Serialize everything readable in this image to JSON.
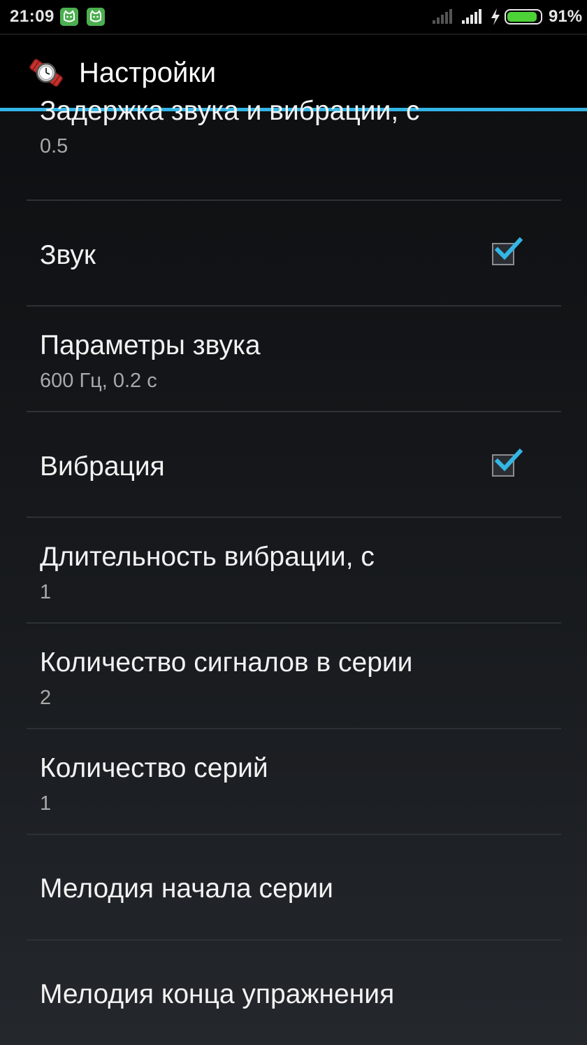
{
  "status_bar": {
    "time": "21:09",
    "notifications": [
      "cat-notification-icon",
      "cat-notification-icon"
    ],
    "battery_percent": "91%",
    "battery_level": 0.91,
    "accent_color": "#4caf50"
  },
  "action_bar": {
    "title": "Настройки",
    "accent_color": "#33b5e5"
  },
  "preferences": [
    {
      "title": "Задержка звука и вибрации, с",
      "summary": "0.5"
    },
    {
      "title": "Звук",
      "checked": true
    },
    {
      "title": "Параметры звука",
      "summary": "600 Гц, 0.2 с"
    },
    {
      "title": "Вибрация",
      "checked": true
    },
    {
      "title": "Длительность вибрации, с",
      "summary": "1"
    },
    {
      "title": "Количество сигналов в серии",
      "summary": "2"
    },
    {
      "title": "Количество серий",
      "summary": "1"
    },
    {
      "title": "Мелодия начала серии"
    },
    {
      "title": "Мелодия конца упражнения"
    }
  ]
}
